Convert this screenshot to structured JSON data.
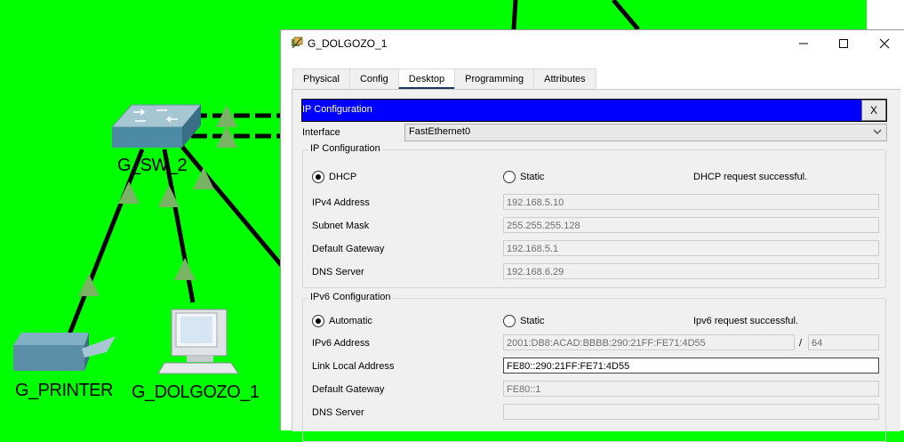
{
  "topology": {
    "switch_label": "G_SW_2",
    "printer_label": "G_PRINTER",
    "pc_label": "G_DOLGOZO_1",
    "colors": {
      "background": "#00ff00",
      "link": "#000000",
      "link_marker": "#78b464"
    }
  },
  "window": {
    "title": "G_DOLGOZO_1",
    "icons": [
      "app-icon",
      "minimize-icon",
      "maximize-icon",
      "close-icon"
    ],
    "tabs": [
      {
        "label": "Physical"
      },
      {
        "label": "Config"
      },
      {
        "label": "Desktop",
        "active": true
      },
      {
        "label": "Programming"
      },
      {
        "label": "Attributes"
      }
    ]
  },
  "ip_config": {
    "panel_title": "IP Configuration",
    "close_label": "X",
    "interface_label": "Interface",
    "interface_value": "FastEthernet0",
    "ipv4": {
      "group_title": "IP Configuration",
      "dhcp_label": "DHCP",
      "static_label": "Static",
      "mode": "DHCP",
      "status": "DHCP request successful.",
      "ipv4_label": "IPv4 Address",
      "ipv4_value": "192.168.5.10",
      "mask_label": "Subnet Mask",
      "mask_value": "255.255.255.128",
      "gateway_label": "Default Gateway",
      "gateway_value": "192.168.5.1",
      "dns_label": "DNS Server",
      "dns_value": "192.168.6.29"
    },
    "ipv6": {
      "group_title": "IPv6 Configuration",
      "auto_label": "Automatic",
      "static_label": "Static",
      "mode": "Automatic",
      "status": "Ipv6 request successful.",
      "ipv6_label": "IPv6 Address",
      "ipv6_value": "2001:DB8:ACAD:BBBB:290:21FF:FE71:4D55",
      "slash": "/",
      "prefix_value": "64",
      "link_local_label": "Link Local Address",
      "link_local_value": "FE80::290:21FF:FE71:4D55",
      "gateway_label": "Default Gateway",
      "gateway_value": "FE80::1",
      "dns_label": "DNS Server",
      "dns_value": ""
    }
  }
}
